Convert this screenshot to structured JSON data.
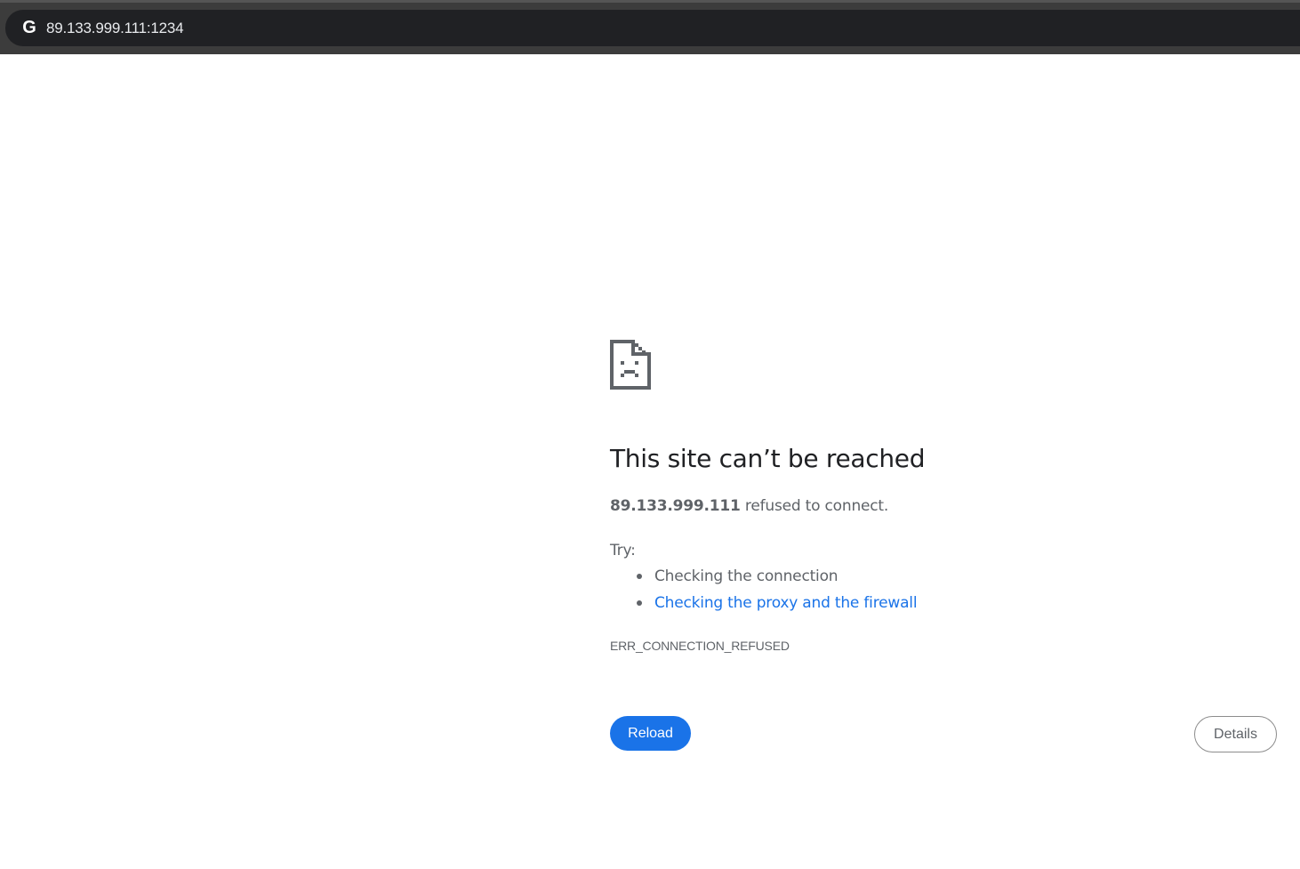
{
  "browser": {
    "site_icon": "google-g-icon",
    "site_icon_glyph": "G",
    "url": "89.133.999.111:1234"
  },
  "error_page": {
    "icon": "sad-page-icon",
    "headline": "This site can’t be reached",
    "host": "89.133.999.111",
    "summary_suffix": " refused to connect.",
    "try_label": "Try:",
    "suggestions": [
      {
        "text": "Checking the connection",
        "is_link": false
      },
      {
        "text": "Checking the proxy and the firewall",
        "is_link": true
      }
    ],
    "error_code": "ERR_CONNECTION_REFUSED"
  },
  "buttons": {
    "reload_label": "Reload",
    "details_label": "Details"
  },
  "colors": {
    "toolbar": "#3c3c3c",
    "omnibox": "#202124",
    "accent_blue": "#1a73e8",
    "text_primary": "#202124",
    "text_secondary": "#5f6368"
  }
}
